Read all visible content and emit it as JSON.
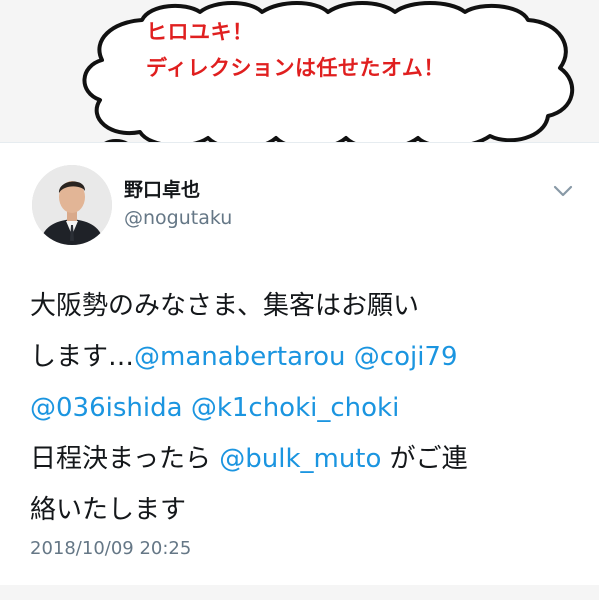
{
  "overlay": {
    "line1": "ヒロユキ！",
    "line2": "ディレクションは任せたオム！",
    "text_color": "#e01f1f"
  },
  "tweet": {
    "display_name": "野口卓也",
    "handle": "@nogutaku",
    "avatar_icon": "profile-photo",
    "menu_icon": "chevron-down-icon",
    "body": {
      "l1": "大阪勢のみなさま、集客はお願い",
      "l2_pre": "します…",
      "m1": "@manabertarou",
      "m2": "@coji79",
      "m3": "@036ishida",
      "m4": "@k1choki_choki",
      "l4_pre": "日程決まったら",
      "m5": "@bulk_muto",
      "l4_post": "がご連",
      "l5": "絡いたします"
    },
    "timestamp": "2018/10/09 20:25",
    "mention_color": "#1b95e0"
  }
}
